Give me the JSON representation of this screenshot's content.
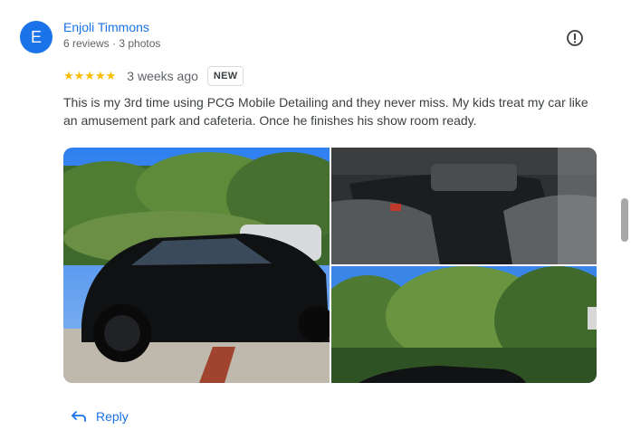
{
  "reviewer": {
    "avatar_initial": "E",
    "name": "Enjoli Timmons",
    "meta": "6 reviews · 3 photos"
  },
  "rating": {
    "stars_text": "★★★★★",
    "value": 5,
    "max": 5
  },
  "time_ago": "3 weeks ago",
  "badge": "NEW",
  "review_text": "This is my 3rd time using PCG Mobile Detailing and they never miss. My kids treat my car like an amusement park and cafeteria. Once he finishes his show room ready.",
  "photos": [
    {
      "subject": "black-car-exterior-photo"
    },
    {
      "subject": "car-interior-console-photo"
    },
    {
      "subject": "trees-and-car-roof-photo"
    }
  ],
  "actions": {
    "reply_label": "Reply"
  },
  "icons": {
    "report": "report-icon",
    "reply": "reply-arrow-icon"
  },
  "colors": {
    "accent": "#1a73e8",
    "star": "#fbbc04",
    "avatar_bg": "#1a73e8"
  }
}
